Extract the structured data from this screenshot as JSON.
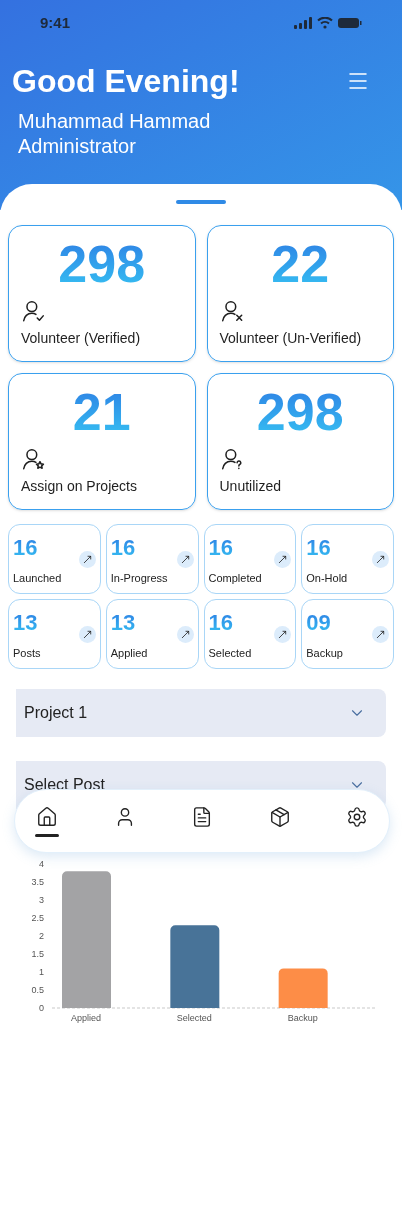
{
  "status_bar": {
    "time": "9:41"
  },
  "header": {
    "greeting": "Good Evening!",
    "name": "Muhammad Hammad",
    "role": "Administrator"
  },
  "stat_cards": [
    {
      "value": "298",
      "label": "Volunteer (Verified)"
    },
    {
      "value": "22",
      "label": "Volunteer (Un-Verified)"
    },
    {
      "value": "21",
      "label": "Assign on Projects"
    },
    {
      "value": "298",
      "label": "Unutilized"
    }
  ],
  "tiles": [
    {
      "value": "16",
      "label": "Launched"
    },
    {
      "value": "16",
      "label": "In-Progress"
    },
    {
      "value": "16",
      "label": "Completed"
    },
    {
      "value": "16",
      "label": "On-Hold"
    },
    {
      "value": "13",
      "label": "Posts"
    },
    {
      "value": "13",
      "label": "Applied"
    },
    {
      "value": "16",
      "label": "Selected"
    },
    {
      "value": "09",
      "label": "Backup"
    }
  ],
  "dropdowns": [
    {
      "value": "Project 1"
    },
    {
      "placeholder": "Select Post"
    }
  ],
  "nav": [
    {
      "selected": true
    },
    {
      "selected": false
    },
    {
      "selected": false
    },
    {
      "selected": false
    },
    {
      "selected": false
    }
  ],
  "chart": {
    "chart_data": {
      "type": "bar",
      "categories": [
        "Applied",
        "Selected",
        "Backup"
      ],
      "values": [
        3.8,
        2.3,
        1.1
      ],
      "colors": [
        "#a3a3a5",
        "#487398",
        "#fd8d47"
      ],
      "ylim": [
        0,
        4
      ],
      "yticks": [
        0,
        {
          "value": 0.5,
          "label": "0.5"
        },
        1,
        {
          "value": 1.5,
          "label": "1.5"
        },
        2,
        {
          "value": 2.5,
          "label": "2.5"
        },
        3,
        {
          "value": 3.5,
          "label": "3.5"
        },
        4
      ]
    }
  }
}
